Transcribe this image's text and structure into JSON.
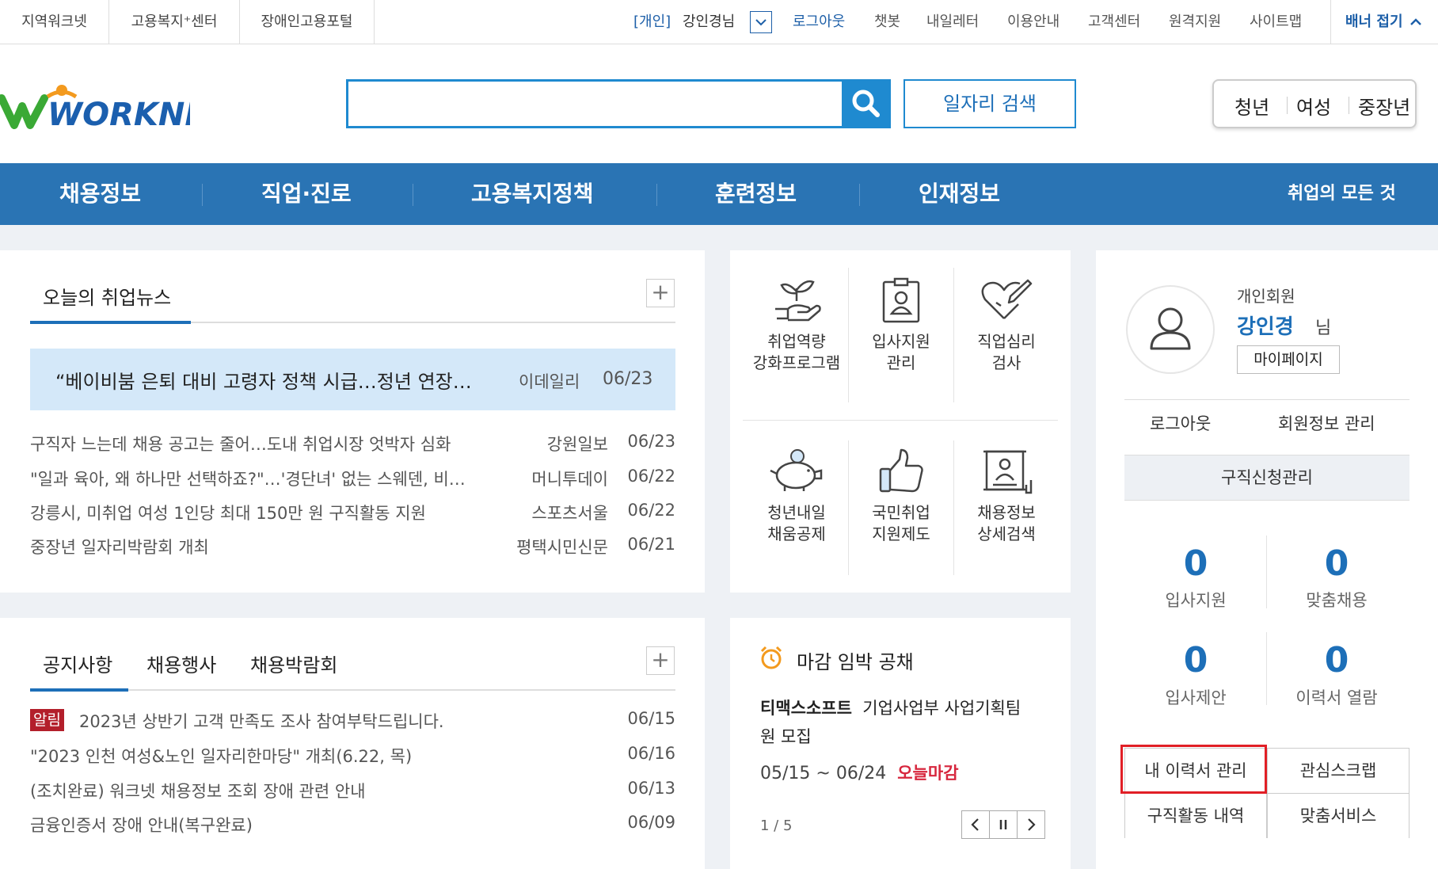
{
  "topbar": {
    "left_links": [
      "지역워크넷",
      "고용복지⁺센터",
      "장애인고용포털"
    ],
    "user_type": "[개인]",
    "user_name": "강인경님",
    "right_links": [
      "로그아웃",
      "챗봇",
      "내일레터",
      "이용안내",
      "고객센터",
      "원격지원",
      "사이트맵"
    ],
    "banner_toggle": "배너 접기"
  },
  "header": {
    "logo_text": "WORKNET",
    "search_value": "",
    "job_search_button": "일자리 검색",
    "age_groups": [
      "청년",
      "여성",
      "중장년"
    ]
  },
  "gnb": {
    "items": [
      "채용정보",
      "직업·진로",
      "고용복지정책",
      "훈련정보",
      "인재정보"
    ],
    "all_link": "취업의 모든 것"
  },
  "news": {
    "tab": "오늘의 취업뉴스",
    "headline": {
      "title": "“베이비붐 은퇴 대비 고령자 정책 시급…정년 연장…",
      "source": "이데일리",
      "date": "06/23"
    },
    "items": [
      {
        "title": "구직자 느는데 채용 공고는 줄어…도내 취업시장 엇박자 심화",
        "source": "강원일보",
        "date": "06/23"
      },
      {
        "title": "\"일과 육아, 왜 하나만 선택하죠?\"…'경단녀' 없는 스웨덴, 비…",
        "source": "머니투데이",
        "date": "06/22"
      },
      {
        "title": "강릉시, 미취업 여성 1인당 최대 150만 원 구직활동 지원",
        "source": "스포츠서울",
        "date": "06/22"
      },
      {
        "title": "중장년 일자리박람회 개최",
        "source": "평택시민신문",
        "date": "06/21"
      }
    ]
  },
  "quick_menu": [
    {
      "label1": "취업역량",
      "label2": "강화프로그램",
      "icon": "sprout-hand-icon"
    },
    {
      "label1": "입사지원",
      "label2": "관리",
      "icon": "id-card-icon"
    },
    {
      "label1": "직업심리",
      "label2": "검사",
      "icon": "heart-check-icon"
    },
    {
      "label1": "청년내일",
      "label2": "채움공제",
      "icon": "piggy-bank-icon"
    },
    {
      "label1": "국민취업",
      "label2": "지원제도",
      "icon": "thumbs-up-icon"
    },
    {
      "label1": "채용정보",
      "label2": "상세검색",
      "icon": "document-person-icon"
    }
  ],
  "notice": {
    "tabs": [
      "공지사항",
      "채용행사",
      "채용박람회"
    ],
    "badge": "알림",
    "items": [
      {
        "title": "2023년 상반기 고객 만족도 조사 참여부탁드립니다.",
        "date": "06/15"
      },
      {
        "title": "\"2023 인천 여성&노인 일자리한마당\" 개최(6.22, 목)",
        "date": "06/16"
      },
      {
        "title": "(조치완료) 워크넷 채용정보 조회 장애 관련 안내",
        "date": "06/13"
      },
      {
        "title": "금융인증서 장애 안내(복구완료)",
        "date": "06/09"
      }
    ]
  },
  "deadline": {
    "title": "마감 임박 공채",
    "company": "티맥스소프트",
    "job_line1": "기업사업부 사업기획팀",
    "job_line2": "원 모집",
    "period": "05/15 ~ 06/24",
    "status": "오늘마감",
    "pager": "1 / 5"
  },
  "user": {
    "member_type": "개인회원",
    "name": "강인경",
    "honorific": "님",
    "mypage_button": "마이페이지",
    "logout": "로그아웃",
    "member_info": "회원정보 관리",
    "job_apply_manage": "구직신청관리",
    "stats": [
      {
        "value": "0",
        "label": "입사지원"
      },
      {
        "value": "0",
        "label": "맞춤채용"
      },
      {
        "value": "0",
        "label": "입사제안"
      },
      {
        "value": "0",
        "label": "이력서 열람"
      }
    ],
    "menu": [
      "내 이력서 관리",
      "관심스크랩",
      "구직활동 내역",
      "맞춤서비스"
    ]
  },
  "colors": {
    "primary": "#2a74b4",
    "accent": "#1f8ad0",
    "highlight_border": "#e11f26",
    "deadline_red": "#d7263d"
  }
}
